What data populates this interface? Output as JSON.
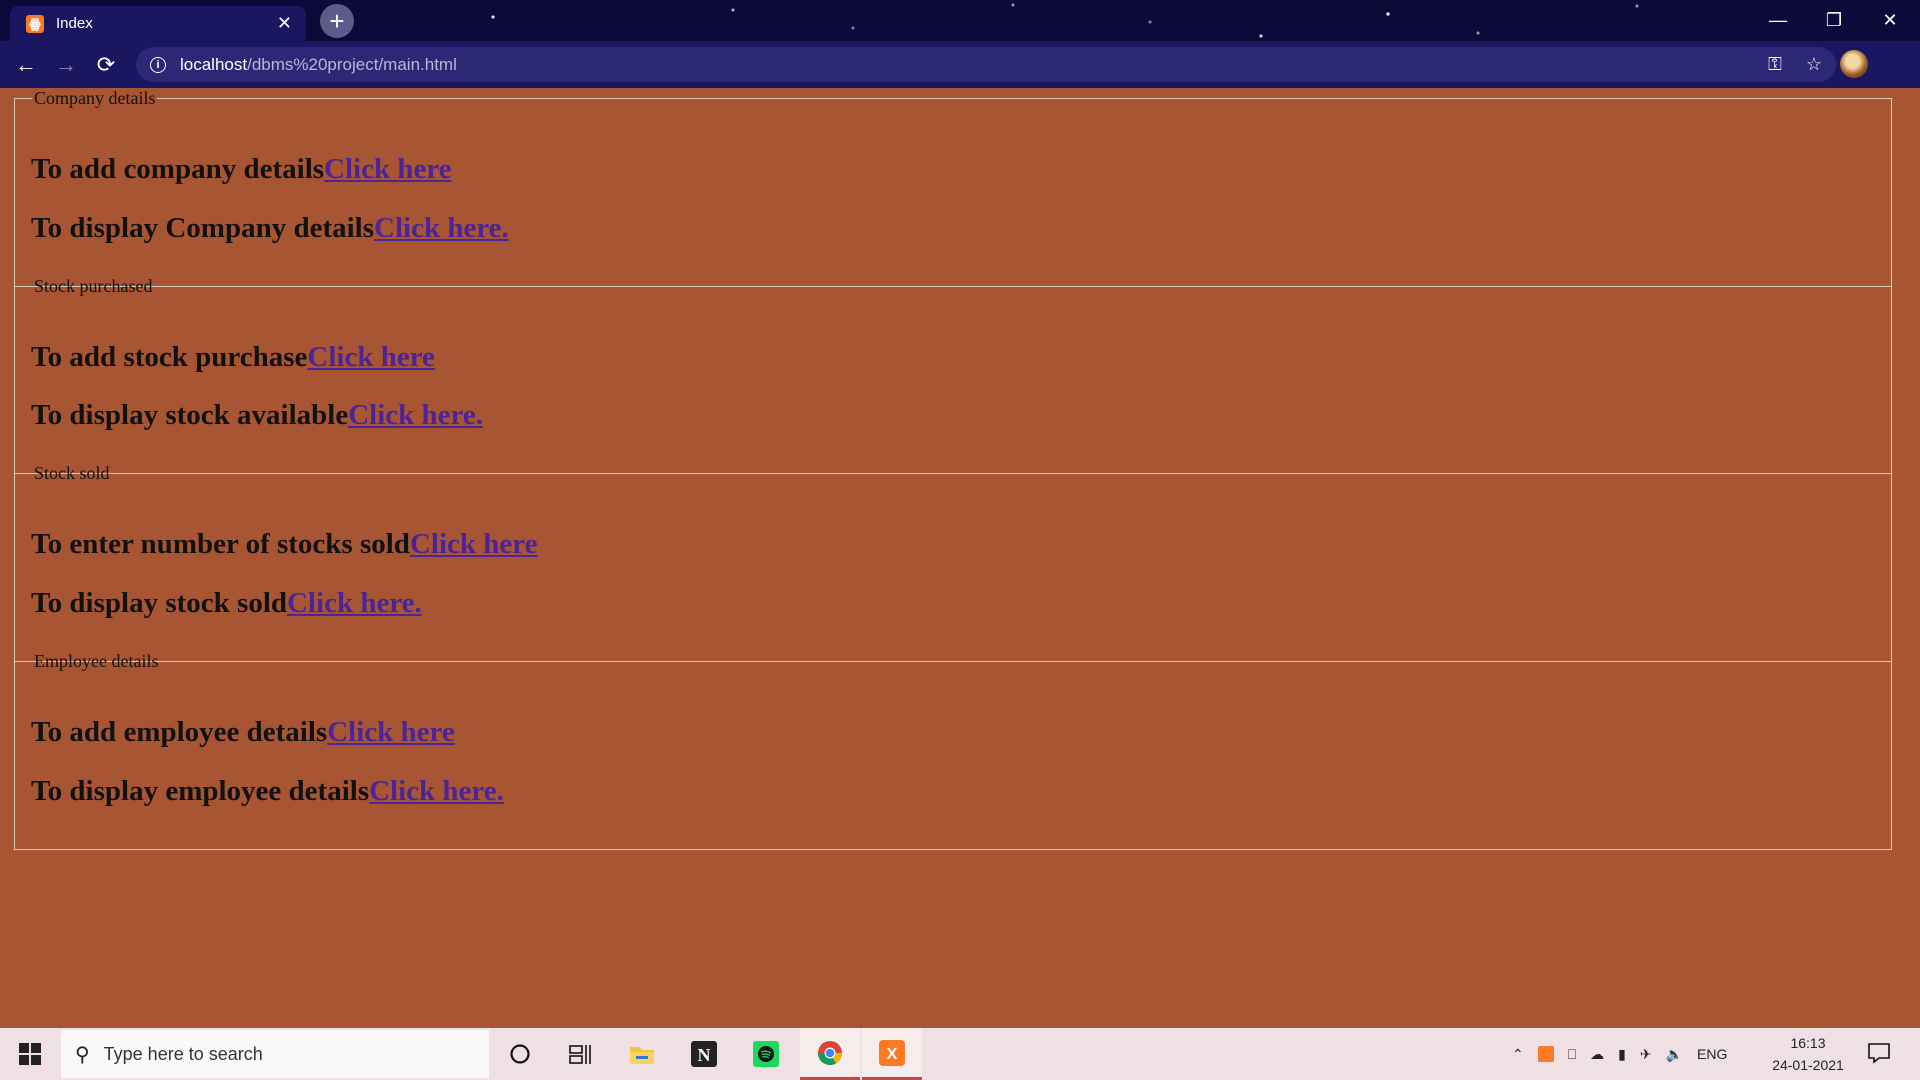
{
  "browser": {
    "tab_title": "Index",
    "tab_favicon": "ꙮ",
    "tab_close": "✕",
    "new_tab": "+",
    "url_host": "localhost",
    "url_path": "/dbms%20project/main.html",
    "icons": {
      "back": "←",
      "forward": "→",
      "reload": "⟳",
      "info": "i",
      "key": "⚿",
      "star": "☆",
      "menu": "⋮",
      "minimize": "—",
      "restore": "❐",
      "close": "✕"
    }
  },
  "sections": [
    {
      "legend": "Company details",
      "rows": [
        {
          "text": "To add company details",
          "link": "Click here"
        },
        {
          "text": "To display Company details",
          "link": "Click here."
        }
      ]
    },
    {
      "legend": "Stock purchased",
      "rows": [
        {
          "text": "To add stock purchase",
          "link": "Click here"
        },
        {
          "text": "To display stock available",
          "link": "Click here."
        }
      ]
    },
    {
      "legend": "Stock sold",
      "rows": [
        {
          "text": "To enter number of stocks sold",
          "link": "Click here"
        },
        {
          "text": "To display stock sold",
          "link": "Click here."
        }
      ]
    },
    {
      "legend": "Employee details",
      "rows": [
        {
          "text": "To add employee details",
          "link": "Click here"
        },
        {
          "text": "To display employee details",
          "link": "Click here."
        }
      ]
    }
  ],
  "taskbar": {
    "search_placeholder": "Type here to search",
    "language": "ENG",
    "time": "16:13",
    "date": "24-01-2021",
    "apps": [
      "cortana-icon",
      "task-view-icon",
      "file-explorer-icon",
      "notion-icon",
      "spotify-icon",
      "chrome-icon",
      "xampp-icon"
    ]
  },
  "colors": {
    "page_background": "#a85533",
    "link": "#4b2498",
    "browser_frame": "#1b1660"
  }
}
